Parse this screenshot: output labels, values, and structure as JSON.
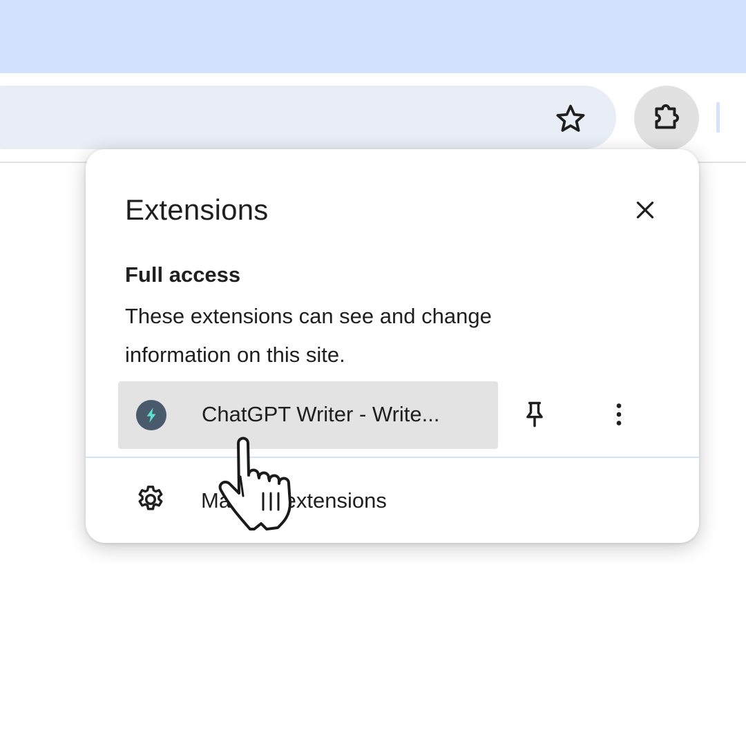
{
  "browser": {
    "icons": {
      "bookmark": "star-outline-icon",
      "extensions": "puzzle-piece-icon"
    },
    "colors": {
      "tab_strip": "#d3e3fd",
      "omnibox": "#e9edf6",
      "extensions_button_active": "#e1e1e1"
    }
  },
  "extensions_popup": {
    "title": "Extensions",
    "close_icon": "close-icon",
    "section": {
      "heading": "Full access",
      "description": "These extensions can see and change information on this site."
    },
    "items": [
      {
        "name": "ChatGPT Writer - Write...",
        "icon": "lightning-bolt-logo",
        "pin_icon": "pin-icon",
        "menu_icon": "more-vert-icon",
        "hovered": true
      }
    ],
    "manage": {
      "label": "Manage extensions",
      "icon": "gear-icon"
    }
  },
  "cursor": {
    "type": "hand-pointer-icon"
  }
}
